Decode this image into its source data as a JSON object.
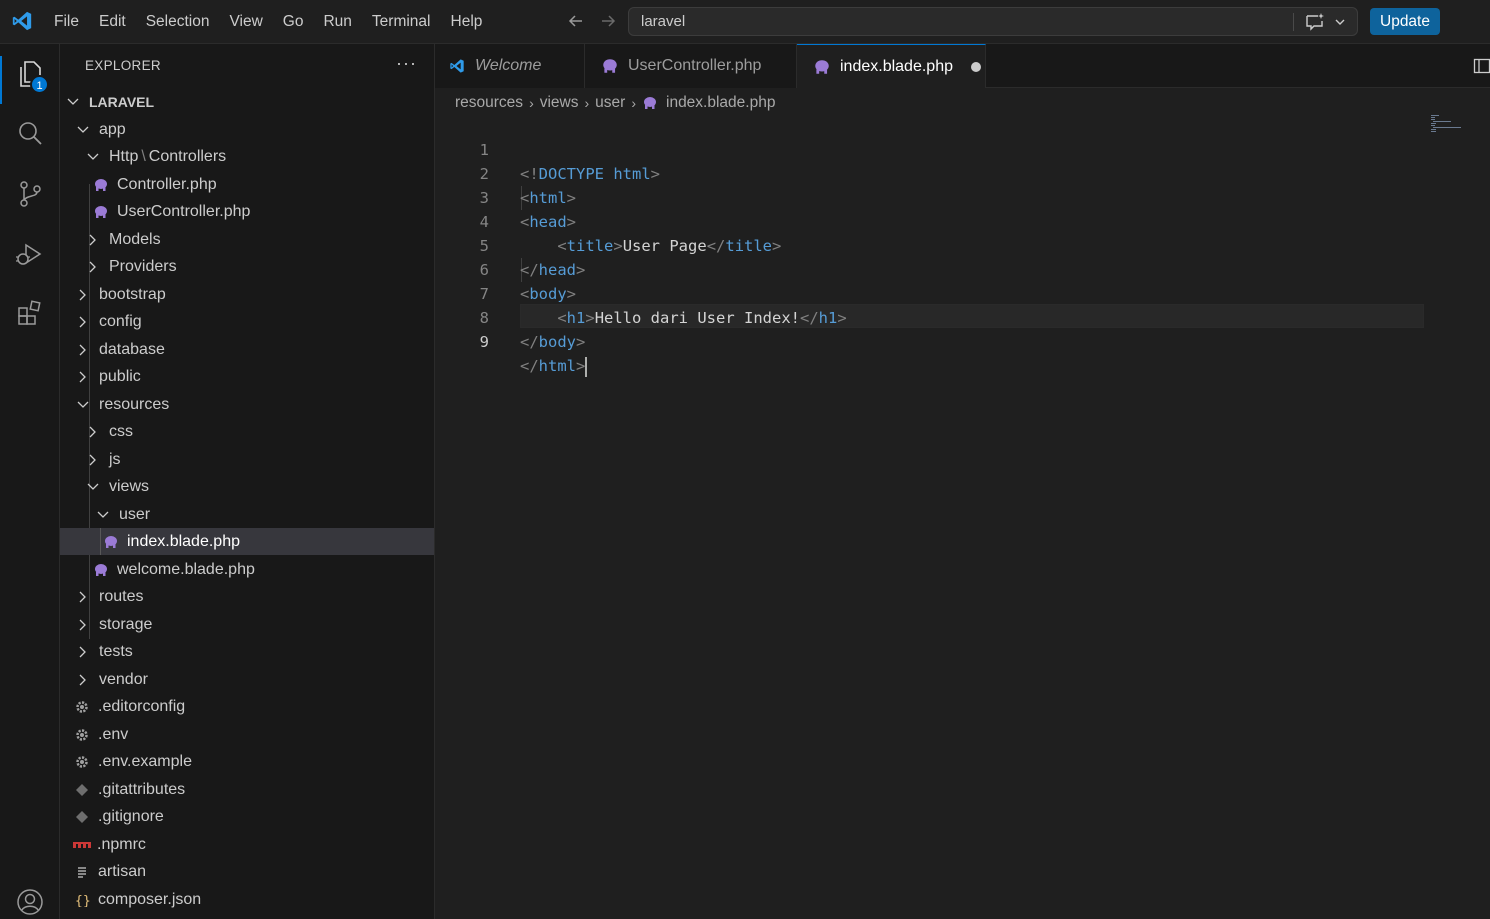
{
  "titlebar": {
    "menu": [
      "File",
      "Edit",
      "Selection",
      "View",
      "Go",
      "Run",
      "Terminal",
      "Help"
    ],
    "search_text": "laravel",
    "update_label": "Update"
  },
  "activity": {
    "explorer_badge": "1"
  },
  "explorer": {
    "title": "EXPLORER",
    "more": "···",
    "root": "LARAVEL",
    "items": [
      {
        "label": "app",
        "twisty": "down"
      },
      {
        "label_a": "Http",
        "sep": "\\",
        "label_b": "Controllers",
        "twisty": "down"
      },
      {
        "label": "Controller.php",
        "icon": "php"
      },
      {
        "label": "UserController.php",
        "icon": "php"
      },
      {
        "label": "Models",
        "twisty": "right"
      },
      {
        "label": "Providers",
        "twisty": "right"
      },
      {
        "label": "bootstrap",
        "twisty": "right"
      },
      {
        "label": "config",
        "twisty": "right"
      },
      {
        "label": "database",
        "twisty": "right"
      },
      {
        "label": "public",
        "twisty": "right"
      },
      {
        "label": "resources",
        "twisty": "down"
      },
      {
        "label": "css",
        "twisty": "right"
      },
      {
        "label": "js",
        "twisty": "right"
      },
      {
        "label": "views",
        "twisty": "down"
      },
      {
        "label": "user",
        "twisty": "down"
      },
      {
        "label": "index.blade.php",
        "icon": "php"
      },
      {
        "label": "welcome.blade.php",
        "icon": "php"
      },
      {
        "label": "routes",
        "twisty": "right"
      },
      {
        "label": "storage",
        "twisty": "right"
      },
      {
        "label": "tests",
        "twisty": "right"
      },
      {
        "label": "vendor",
        "twisty": "right"
      },
      {
        "label": ".editorconfig",
        "icon": "gear"
      },
      {
        "label": ".env",
        "icon": "gear"
      },
      {
        "label": ".env.example",
        "icon": "gear"
      },
      {
        "label": ".gitattributes",
        "icon": "git"
      },
      {
        "label": ".gitignore",
        "icon": "git"
      },
      {
        "label": ".npmrc",
        "icon": "npm"
      },
      {
        "label": "artisan",
        "icon": "lines"
      },
      {
        "label": "composer.json",
        "icon": "braces"
      }
    ]
  },
  "tabs": [
    {
      "label": "Welcome"
    },
    {
      "label": "UserController.php"
    },
    {
      "label": "index.blade.php"
    }
  ],
  "breadcrumbs": [
    "resources",
    "views",
    "user",
    "index.blade.php"
  ],
  "code": {
    "line_numbers": [
      "1",
      "2",
      "3",
      "4",
      "5",
      "6",
      "7",
      "8",
      "9"
    ],
    "l1_open": "<!",
    "l1_doctype": "DOCTYPE",
    "l1_html": "html",
    "l1_close": ">",
    "l2_open": "<",
    "l2_tag": "html",
    "l2_close": ">",
    "l3_open": "<",
    "l3_tag": "head",
    "l3_close": ">",
    "l4_open": "<",
    "l4_tag": "title",
    "l4_close": ">",
    "l4_text": "User Page",
    "l4_open2": "</",
    "l4_tag2": "title",
    "l4_close2": ">",
    "l5_open": "</",
    "l5_tag": "head",
    "l5_close": ">",
    "l6_open": "<",
    "l6_tag": "body",
    "l6_close": ">",
    "l7_open": "<",
    "l7_tag": "h1",
    "l7_close": ">",
    "l7_text": "Hello dari User Index!",
    "l7_open2": "</",
    "l7_tag2": "h1",
    "l7_close2": ">",
    "l8_open": "</",
    "l8_tag": "body",
    "l8_close": ">",
    "l9_open": "</",
    "l9_tag": "html",
    "l9_close": ">"
  }
}
